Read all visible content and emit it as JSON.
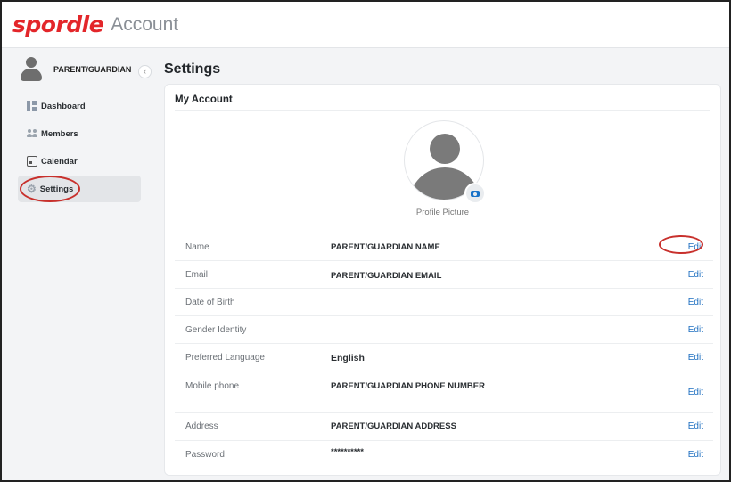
{
  "header": {
    "brand": "spordle",
    "app_title": "Account"
  },
  "sidebar": {
    "user_name": "PARENT/GUARDIAN",
    "collapse_glyph": "‹",
    "items": [
      {
        "label": "Dashboard",
        "icon": "dashboard-grid-icon",
        "active": false
      },
      {
        "label": "Members",
        "icon": "members-icon",
        "active": false
      },
      {
        "label": "Calendar",
        "icon": "calendar-icon",
        "active": false
      },
      {
        "label": "Settings",
        "icon": "gear-icon",
        "active": true
      }
    ]
  },
  "main": {
    "title": "Settings",
    "card_title": "My Account",
    "profile_picture_label": "Profile Picture",
    "edit_label": "Edit",
    "fields": [
      {
        "label": "Name",
        "value": "PARENT/GUARDIAN NAME"
      },
      {
        "label": "Email",
        "value": "PARENT/GUARDIAN EMAIL"
      },
      {
        "label": "Date of Birth",
        "value": ""
      },
      {
        "label": "Gender Identity",
        "value": ""
      },
      {
        "label": "Preferred Language",
        "value": "English"
      },
      {
        "label": "Mobile phone",
        "value": "PARENT/GUARDIAN PHONE NUMBER"
      },
      {
        "label": "Address",
        "value": "PARENT/GUARDIAN ADDRESS"
      },
      {
        "label": "Password",
        "value": "**********"
      }
    ]
  },
  "colors": {
    "brand": "#e3262a",
    "link": "#1e6fc0",
    "annotation": "#c8302c"
  }
}
